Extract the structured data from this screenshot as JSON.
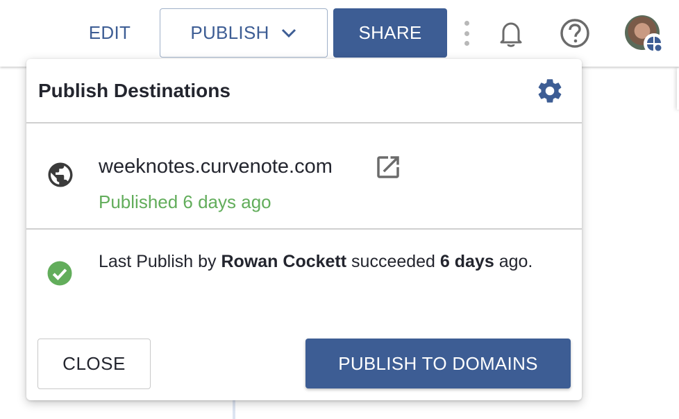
{
  "toolbar": {
    "edit_label": "EDIT",
    "publish_label": "PUBLISH",
    "share_label": "SHARE"
  },
  "popover": {
    "title": "Publish Destinations",
    "destination": {
      "domain": "weeknotes.curvenote.com",
      "status": "Published 6 days ago"
    },
    "last_publish": {
      "prefix": "Last Publish by ",
      "user": "Rowan Cockett",
      "middle": " succeeded ",
      "when": "6 days",
      "suffix": " ago."
    },
    "close_label": "CLOSE",
    "publish_to_domains_label": "PUBLISH TO DOMAINS"
  },
  "colors": {
    "brand": "#3d5d94",
    "success": "#62ad5b"
  }
}
